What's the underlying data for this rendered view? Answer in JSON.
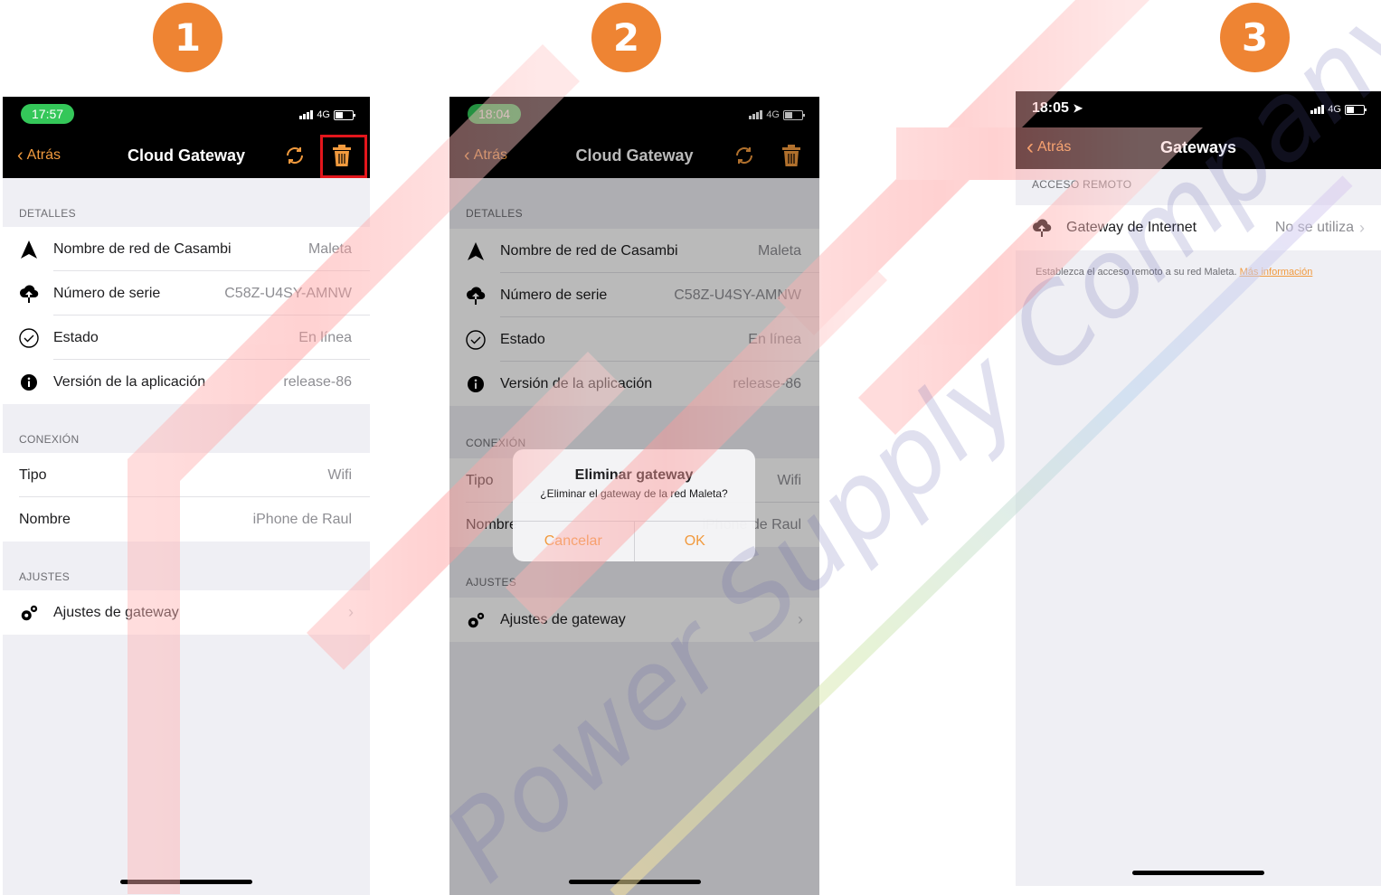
{
  "steps": [
    "1",
    "2",
    "3"
  ],
  "colors": {
    "accent": "#f19a3e",
    "badge": "#ee8433",
    "highlight": "#e3161c",
    "status_green": "#34c759"
  },
  "status_bar": {
    "network": "4G"
  },
  "screen1": {
    "time": "17:57",
    "back": "Atrás",
    "title": "Cloud Gateway",
    "sections": {
      "detalles": "DETALLES",
      "conexion": "CONEXIÓN",
      "ajustes": "AJUSTES"
    },
    "rows": {
      "network_name": {
        "label": "Nombre de red de Casambi",
        "value": "Maleta",
        "icon": "navigation-arrow-icon"
      },
      "serial": {
        "label": "Número de serie",
        "value": "C58Z-U4SY-AMNW",
        "icon": "cloud-upload-icon"
      },
      "status": {
        "label": "Estado",
        "value": "En línea",
        "icon": "checkmark-circle-icon"
      },
      "version": {
        "label": "Versión de la aplicación",
        "value": "release-86",
        "icon": "info-icon"
      },
      "type": {
        "label": "Tipo",
        "value": "Wifi"
      },
      "name": {
        "label": "Nombre",
        "value": "iPhone de Raul"
      },
      "settings": {
        "label": "Ajustes de gateway",
        "icon": "gears-icon"
      }
    }
  },
  "screen2": {
    "time": "18:04",
    "back": "Atrás",
    "title": "Cloud Gateway",
    "sections": {
      "detalles": "DETALLES",
      "conexion": "CONEXIÓN",
      "ajustes": "AJUSTES"
    },
    "rows": {
      "network_name": {
        "label": "Nombre de red de Casambi",
        "value": "Maleta"
      },
      "serial": {
        "label": "Número de serie",
        "value": "C58Z-U4SY-AMNW"
      },
      "status": {
        "label": "Estado",
        "value": "En línea"
      },
      "version": {
        "label": "Versión de la aplicación",
        "value": "release-86"
      },
      "type": {
        "label": "Tipo",
        "value": "Wifi"
      },
      "name": {
        "label": "Nombre",
        "value": "iPhone de Raul"
      },
      "settings": {
        "label": "Ajustes de gateway"
      }
    },
    "dialog": {
      "title": "Eliminar gateway",
      "message": "¿Eliminar el gateway de la red Maleta?",
      "cancel": "Cancelar",
      "ok": "OK"
    }
  },
  "screen3": {
    "time": "18:05",
    "back": "Atrás",
    "title": "Gateways",
    "section": "ACCESO REMOTO",
    "row": {
      "label": "Gateway de Internet",
      "value": "No se utiliza",
      "icon": "cloud-upload-icon"
    },
    "footnote": "Establezca el acceso remoto a su red Maleta.",
    "footnote_link": "Más información"
  },
  "watermark": {
    "text": "Power Supply Company"
  }
}
